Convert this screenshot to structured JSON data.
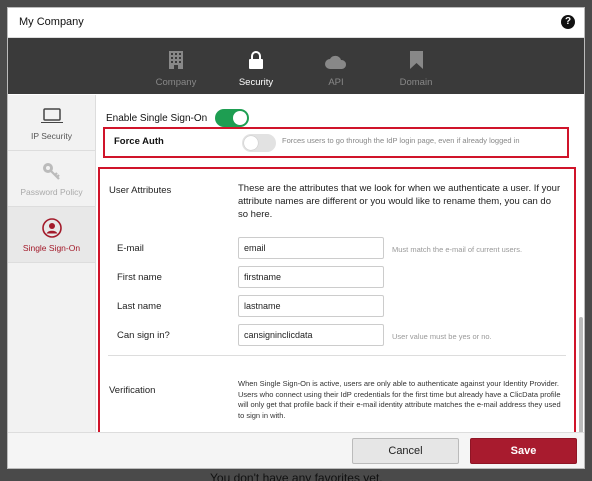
{
  "background": {
    "empty_message": "You don't have any favorites yet."
  },
  "modal": {
    "title": "My Company",
    "help_icon": "?"
  },
  "topnav": {
    "items": [
      {
        "label": "Company",
        "icon": "building-icon",
        "active": false
      },
      {
        "label": "Security",
        "icon": "lock-icon",
        "active": true
      },
      {
        "label": "API",
        "icon": "cloud-icon",
        "active": false
      },
      {
        "label": "Domain",
        "icon": "bookmark-icon",
        "active": false
      }
    ]
  },
  "sidebar": {
    "items": [
      {
        "label": "IP Security",
        "icon": "laptop-icon"
      },
      {
        "label": "Password Policy",
        "icon": "key-icon",
        "disabled": true
      },
      {
        "label": "Single Sign-On",
        "icon": "user-circle-icon",
        "active": true
      }
    ]
  },
  "sso": {
    "enable_label": "Enable Single Sign-On",
    "enabled": true,
    "force_auth_label": "Force Auth",
    "force_auth_enabled": false,
    "force_auth_desc": "Forces users to go through the IdP login page, even if already logged in"
  },
  "attributes": {
    "section_label": "User Attributes",
    "description": "These are the attributes that we look for when we authenticate a user. If your attribute names are different or you would like to rename them, you can do so here.",
    "fields": [
      {
        "label": "E-mail",
        "value": "email",
        "hint": "Must match the e-mail of current users."
      },
      {
        "label": "First name",
        "value": "firstname",
        "hint": ""
      },
      {
        "label": "Last name",
        "value": "lastname",
        "hint": ""
      },
      {
        "label": "Can sign in?",
        "value": "cansigninclicdata",
        "hint": "User value must be yes or no."
      }
    ]
  },
  "verification": {
    "section_label": "Verification",
    "description": "When Single Sign-On is active, users are only able to authenticate against your Identity Provider. Users who connect using their IdP credentials for the first time but already have a ClicData profile will only get that profile back if their e-mail identity attribute matches the e-mail address they used to sign in with."
  },
  "footer": {
    "cancel_label": "Cancel",
    "save_label": "Save"
  },
  "colors": {
    "accent": "#a81b2e",
    "toggle_on": "#1e9e52",
    "highlight_border": "#d0142a",
    "nav_bg": "#3a3a3a"
  }
}
